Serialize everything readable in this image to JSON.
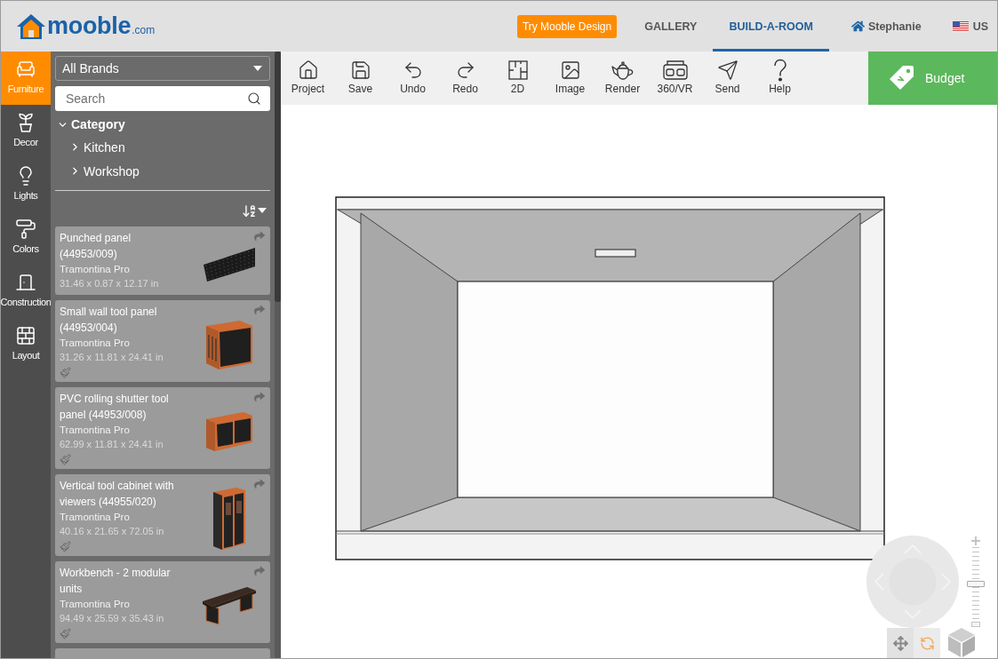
{
  "header": {
    "logo": {
      "text": "mooble",
      "suffix": ".com"
    },
    "cta": "Try Mooble Design",
    "nav": [
      {
        "label": "GALLERY",
        "selected": false
      },
      {
        "label": "BUILD-A-ROOM",
        "selected": true
      }
    ],
    "user": "Stephanie",
    "locale": "US"
  },
  "rail": [
    {
      "label": "Furniture",
      "selected": true
    },
    {
      "label": "Decor",
      "selected": false
    },
    {
      "label": "Lights",
      "selected": false
    },
    {
      "label": "Colors",
      "selected": false
    },
    {
      "label": "Construction",
      "selected": false
    },
    {
      "label": "Layout",
      "selected": false
    }
  ],
  "catalog": {
    "brand": "All Brands",
    "search": {
      "placeholder": "Search"
    },
    "category": {
      "label": "Category",
      "expanded": true,
      "children": [
        {
          "label": "Kitchen",
          "expanded": false
        },
        {
          "label": "Workshop",
          "expanded": false
        }
      ]
    },
    "products": [
      {
        "name": "Punched panel (44953/009)",
        "brand": "Tramontina Pro",
        "dimensions": "31.46 x 0.87 x 12.17 in",
        "paintable": false
      },
      {
        "name": "Small wall tool panel (44953/004)",
        "brand": "Tramontina Pro",
        "dimensions": "31.26 x 11.81 x 24.41 in",
        "paintable": true
      },
      {
        "name": "PVC rolling shutter tool panel (44953/008)",
        "brand": "Tramontina Pro",
        "dimensions": "62.99 x 11.81 x 24.41 in",
        "paintable": true
      },
      {
        "name": "Vertical tool cabinet with viewers (44955/020)",
        "brand": "Tramontina Pro",
        "dimensions": "40.16 x 21.65 x 72.05 in",
        "paintable": true
      },
      {
        "name": "Workbench - 2 modular units",
        "brand": "Tramontina Pro",
        "dimensions": "94.49 x 25.59 x 35.43 in",
        "paintable": true
      }
    ],
    "more_below": true
  },
  "toolbar": {
    "tools": [
      "Project",
      "Save",
      "Undo",
      "Redo",
      "2D",
      "Image",
      "Render",
      "360/VR",
      "Send",
      "Help"
    ],
    "budget": "Budget"
  },
  "viewer": {
    "zoom": {
      "level": 0.5
    }
  }
}
